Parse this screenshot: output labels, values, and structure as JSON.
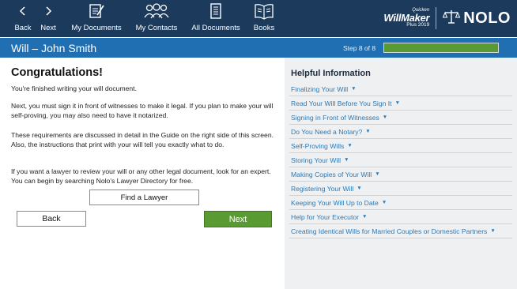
{
  "toolbar": {
    "back": "Back",
    "next": "Next",
    "my_documents": "My Documents",
    "my_contacts": "My Contacts",
    "all_documents": "All Documents",
    "books": "Books"
  },
  "brand": {
    "quicken": "Quicken",
    "willmaker": "WillMaker",
    "plus": "Plus 2019",
    "nolo": "NOLO"
  },
  "titlebar": {
    "title": "Will – John Smith",
    "step": "Step 8 of 8",
    "progress_fraction": 1.0
  },
  "main": {
    "heading": "Congratulations!",
    "para1": "You're finished writing your will document.",
    "para2": "Next, you must sign it in front of witnesses to make it legal. If you plan to make your will self-proving, you may also need to have it notarized.",
    "para3": "These requirements are discussed in detail in the Guide on the right side of this screen. Also, the instructions that print with your will tell you exactly what to do.",
    "para4": "If you want a lawyer to review your will or any other legal document, look for an expert. You can begin by searching Nolo's Lawyer Directory for free.",
    "find_lawyer_button": "Find a Lawyer",
    "back_button": "Back",
    "next_button": "Next"
  },
  "helpful": {
    "title": "Helpful Information",
    "links": [
      "Finalizing Your Will",
      "Read Your Will Before You Sign It",
      "Signing in Front of Witnesses",
      "Do You Need a Notary?",
      "Self-Proving Wills",
      "Storing Your Will",
      "Making Copies of Your Will",
      "Registering Your Will",
      "Keeping Your Will Up to Date",
      "Help for Your Executor",
      "Creating Identical Wills for Married Couples or Domestic Partners"
    ]
  },
  "colors": {
    "toolbar_bg": "#1b3a5c",
    "titlebar_bg": "#1f6fb2",
    "accent_green": "#5a9a32",
    "link_blue": "#2b7ab8"
  },
  "icons": [
    "chevron-left-icon",
    "chevron-right-icon",
    "document-edit-icon",
    "contacts-group-icon",
    "documents-list-icon",
    "open-book-icon",
    "scales-of-justice-icon",
    "caret-down-icon"
  ]
}
